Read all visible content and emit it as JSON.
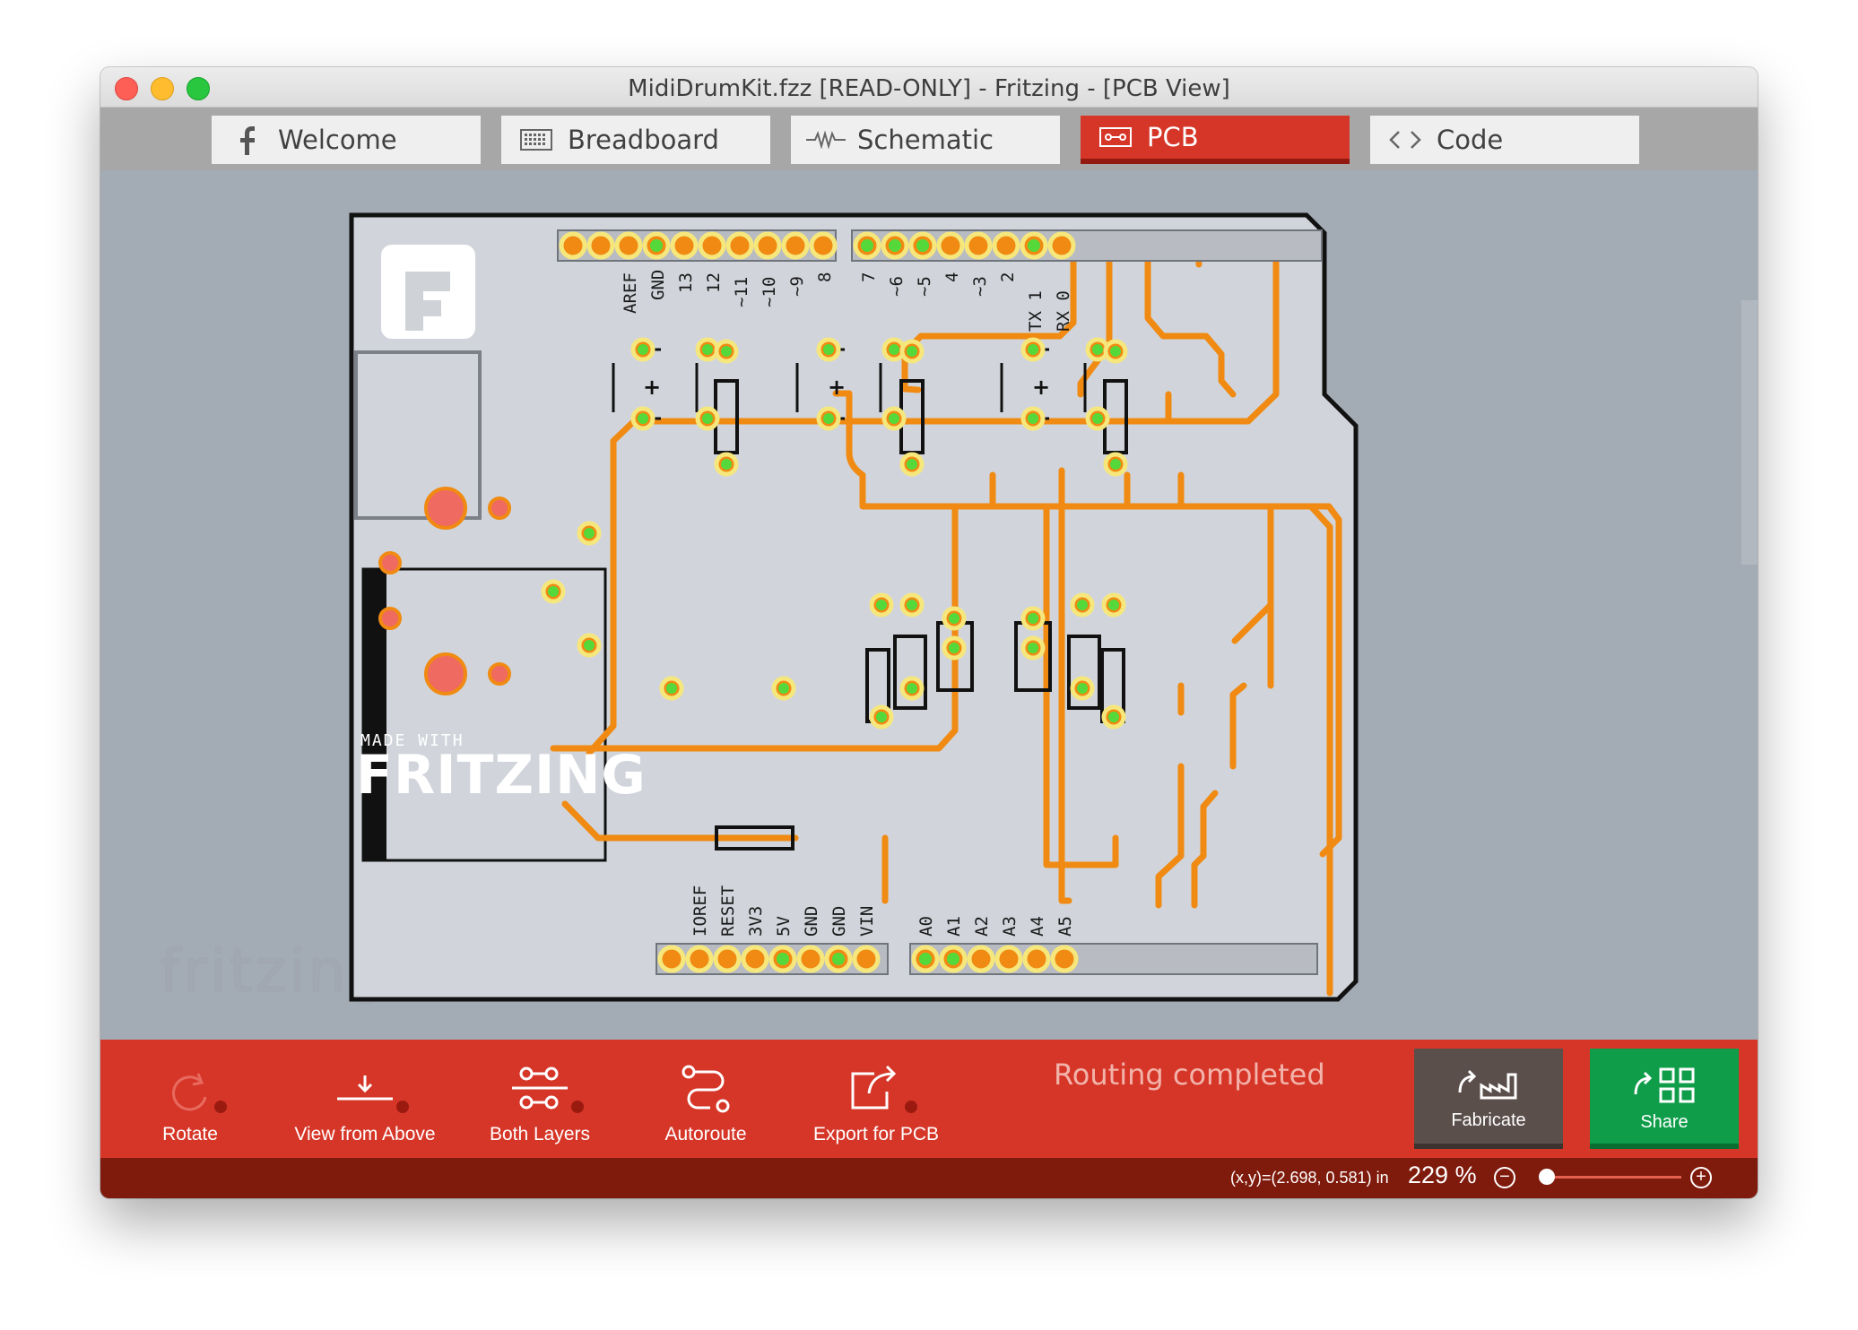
{
  "window": {
    "title": "MidiDrumKit.fzz [READ-ONLY]  - Fritzing - [PCB View]"
  },
  "tabs": [
    {
      "label": "Welcome",
      "icon": "fritzing-f-icon"
    },
    {
      "label": "Breadboard",
      "icon": "breadboard-icon"
    },
    {
      "label": "Schematic",
      "icon": "schematic-icon"
    },
    {
      "label": "PCB",
      "icon": "pcb-icon",
      "active": true
    },
    {
      "label": "Code",
      "icon": "code-icon"
    }
  ],
  "board": {
    "top_pin_labels_left": [
      "AREF",
      "GND",
      "13",
      "12",
      "~11",
      "~10",
      "~9",
      "8"
    ],
    "top_pin_labels_right": [
      "7",
      "~6",
      "~5",
      "4",
      "~3",
      "2",
      "TX 1",
      "RX 0"
    ],
    "bottom_pin_labels_power": [
      "IOREF",
      "RESET",
      "3V3",
      "5V",
      "GND",
      "GND",
      "VIN"
    ],
    "bottom_pin_labels_analog": [
      "A0",
      "A1",
      "A2",
      "A3",
      "A4",
      "A5"
    ],
    "logo_small": "MADE WITH",
    "logo_big": "FRITZING",
    "plus_marks": [
      "+",
      "+",
      "+"
    ],
    "colors": {
      "trace": "#f08a12",
      "pad_ring": "#f6e77c",
      "pad_connected": "#55d93a",
      "board": "#d1d5db",
      "big_pad": "#ef6a60"
    }
  },
  "watermark": "fritzing",
  "toolbar": {
    "rotate": "Rotate",
    "view_from_above": "View from Above",
    "both_layers": "Both Layers",
    "autoroute": "Autoroute",
    "export_pcb": "Export for PCB",
    "status": "Routing completed",
    "fabricate": "Fabricate",
    "share": "Share"
  },
  "statusbar": {
    "coords": "(x,y)=(2.698, 0.581) in",
    "zoom_value": "229",
    "zoom_unit": "%",
    "zoom_level": 0.05
  }
}
